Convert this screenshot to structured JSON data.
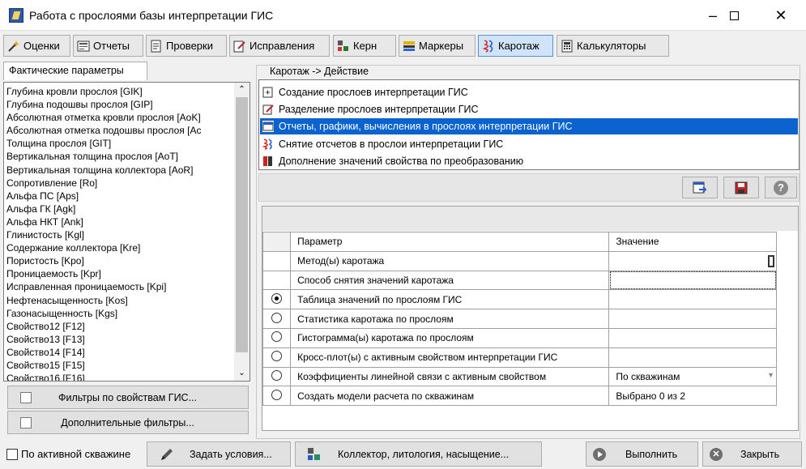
{
  "window": {
    "title": "Работа с прослоями базы интерпретации ГИС"
  },
  "tabs": [
    {
      "label": "Оценки",
      "icon": "wand-icon"
    },
    {
      "label": "Отчеты",
      "icon": "report-icon"
    },
    {
      "label": "Проверки",
      "icon": "check-doc-icon"
    },
    {
      "label": "Исправления",
      "icon": "edit-doc-icon"
    },
    {
      "label": "Керн",
      "icon": "core-icon"
    },
    {
      "label": "Маркеры",
      "icon": "markers-icon"
    },
    {
      "label": "Каротаж",
      "icon": "logging-icon"
    },
    {
      "label": "Калькуляторы",
      "icon": "calculator-icon"
    }
  ],
  "left_panel": {
    "tab_label": "Фактические параметры",
    "items": [
      "Глубина кровли прослоя [GIK]",
      "Глубина подошвы прослоя [GIP]",
      "Абсолютная отметка кровли прослоя [AoK]",
      "Абсолютная отметка подошвы прослоя [Ac",
      "Толщина прослоя [GIT]",
      "Вертикальная толщина прослоя [AoT]",
      "Вертикальная толщина коллектора [AoR]",
      "Сопротивление [Ro]",
      "Альфа ПС [Aps]",
      "Альфа ГК [Agk]",
      "Альфа НКТ [Ank]",
      "Глинистость [Kgl]",
      "Содержание коллектора [Kre]",
      "Пористость [Kpo]",
      "Проницаемость [Kpr]",
      "Исправленная проницаемость [Kpi]",
      "Нефтенасыщенность [Kos]",
      "Газонасыщенность [Kgs]",
      "Свойство12 [F12]",
      "Свойство13 [F13]",
      "Свойство14 [F14]",
      "Свойство15 [F15]",
      "Свойство16 [F16]"
    ],
    "filter_gis": "Фильтры по свойствам ГИС...",
    "filter_extra": "Дополнительные фильтры..."
  },
  "action_group": {
    "caption": "Каротаж -> Действие",
    "actions": [
      {
        "label": "Создание прослоев интерпретации ГИС",
        "icon": "create-icon",
        "selected": false
      },
      {
        "label": "Разделение прослоев интерпретации ГИС",
        "icon": "split-icon",
        "selected": false
      },
      {
        "label": "Отчеты, графики, вычисления в прослоях интерпретации ГИС",
        "icon": "report-table-icon",
        "selected": true
      },
      {
        "label": "Снятие отсчетов в прослои интерпретации ГИС",
        "icon": "logging-curve-icon",
        "selected": false
      },
      {
        "label": "Дополнение значений свойства по преобразованию",
        "icon": "transform-icon",
        "selected": false
      }
    ]
  },
  "params_table": {
    "header_param": "Параметр",
    "header_value": "Значение",
    "rows": [
      {
        "param": "Метод(ы) каротажа",
        "value": "",
        "radio": null
      },
      {
        "param": "Способ снятия значений каротажа",
        "value": "",
        "radio": null
      },
      {
        "param": "Таблица значений по прослоям ГИС",
        "value": "",
        "radio": true
      },
      {
        "param": "Статистика каротажа по прослоям",
        "value": "",
        "radio": false
      },
      {
        "param": "Гистограмма(ы) каротажа по прослоям",
        "value": "",
        "radio": false
      },
      {
        "param": "Кросс-плот(ы) с активным свойством интерпретации ГИС",
        "value": "",
        "radio": false
      },
      {
        "param": "Коэффициенты линейной связи с активным свойством",
        "value": "По скважинам",
        "radio": false
      },
      {
        "param": "Создать модели расчета по скважинам",
        "value": "Выбрано 0 из 2",
        "radio": false
      }
    ]
  },
  "bottom": {
    "active_well_label": "По активной скважине",
    "set_conditions": "Задать условия...",
    "collector": "Коллектор, литология, насыщение...",
    "run": "Выполнить",
    "close": "Закрыть"
  },
  "colors": {
    "selection": "#0a63cf",
    "active_tab": "#cfe3f9"
  }
}
